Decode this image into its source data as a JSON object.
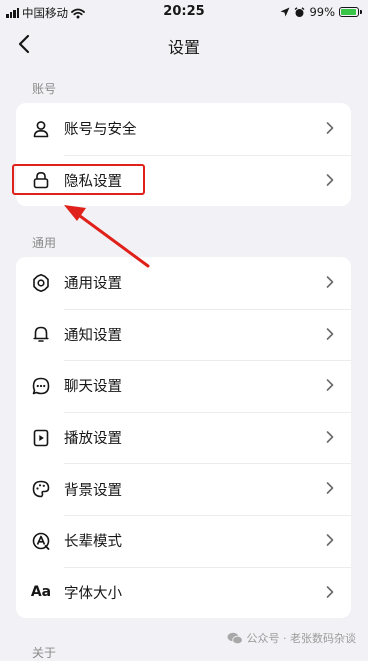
{
  "status_bar": {
    "carrier": "中国移动",
    "time": "20:25",
    "battery_text": "99%",
    "battery_level": 0.99,
    "battery_color": "#38c548"
  },
  "nav": {
    "title": "设置",
    "back_icon": "chevron-left-icon"
  },
  "sections": [
    {
      "label": "账号",
      "items": [
        {
          "label": "账号与安全",
          "icon": "person-icon"
        },
        {
          "label": "隐私设置",
          "icon": "lock-icon",
          "highlighted": true
        }
      ]
    },
    {
      "label": "通用",
      "items": [
        {
          "label": "通用设置",
          "icon": "gear-icon"
        },
        {
          "label": "通知设置",
          "icon": "bell-icon"
        },
        {
          "label": "聊天设置",
          "icon": "chat-bubble-icon"
        },
        {
          "label": "播放设置",
          "icon": "play-icon"
        },
        {
          "label": "背景设置",
          "icon": "palette-icon"
        },
        {
          "label": "长辈模式",
          "icon": "elder-mode-icon"
        },
        {
          "label": "字体大小",
          "icon": "font-size-icon",
          "icon_text": "Aa"
        }
      ]
    },
    {
      "label": "关于"
    }
  ],
  "annotation": {
    "color": "#e0201a"
  },
  "watermark": {
    "text": "公众号 · 老张数码杂谈"
  }
}
